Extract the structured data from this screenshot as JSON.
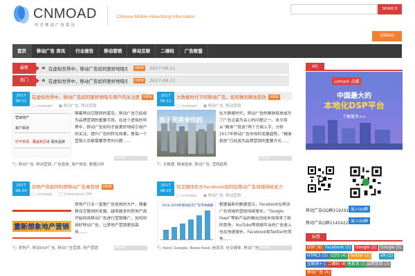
{
  "brand": {
    "name": "CNMOAD",
    "subtitle": "中文移动广告资讯",
    "tagline": "Chinese Mobile Advertising Information"
  },
  "search": {
    "placeholder": "",
    "button": "SEARCH"
  },
  "rss_label": "订阅RSS",
  "nav": [
    "首页",
    "移动广告 资讯",
    "行业报告",
    "移动营销",
    "移动互联",
    "二维码",
    "广告联盟"
  ],
  "ticker": [
    {
      "badge": "最新",
      "title": "在虚拟世界中，移动广告如何更好地吸引用户的关注度",
      "view": "VIEW",
      "date": "2017-09-11"
    },
    {
      "badge": "热门",
      "title": "在虚拟世界中，移动广告如何更好地吸引用户的关注度",
      "view": "VIEW",
      "date": "2017-09-11"
    }
  ],
  "articles": [
    {
      "year": "2017",
      "day": "09-11",
      "title": "在虚拟世界中，移动广告如何更好地吸引用户的关注度",
      "view": "VIEW",
      "author": "cnmoad",
      "comments": "",
      "category": "移动广告, 移动营销",
      "excerpt": "随着移动互联网的普及，移动广告已经成为品牌营销的重要手段。在这个虚拟的世界中，移动广告如何才能更好地吸引用户的关注，提升广告的转化效果，是每一个营销人员都需要思考的问题……",
      "read": "Read",
      "tags": "移动广告, 移动营销, 广告投放, 用户体验, 数据分析",
      "thumb_text": [
        "营销地产",
        "客户渠道",
        "打开资源、覆盖新区域",
        "服务品牌"
      ]
    },
    {
      "year": "2017",
      "day": "09-11",
      "title": "大数据时代下的移动广告，如何做到精准投放",
      "view": "VIEW",
      "author": "cnmoad",
      "comments": "",
      "category": "移动广告, 移动营销",
      "excerpt": "在大数据时代，移动广告的精准投放成为了广告主最为关心的问题之一。本文将从“精准”“投放”两个方面入手，分析2017年移动广告市场的发展趋势。“精准投放”已经成为品牌营销的重要方式……",
      "read": "Read",
      "tags": "大数据, 精准投放, 移动广告, 营销趋势",
      "thumb_text": [
        "房子是用来住的"
      ]
    },
    {
      "year": "2017",
      "day": "08-24",
      "title": "房地产商如何利用移动广告做营销",
      "view": "VIEW",
      "author": "cnmoad",
      "comments": "Comments Off",
      "category": "移动营销",
      "excerpt": "房地产行业一直是广告投放的大户，随着移动互联网的发展，越来越多的房地产商开始利用移动广告进行营销推广。如何利用好移动广告，让房地产营销更加高效……",
      "read": "Read",
      "tags": "房地产, 移动DSP广告, 移动广告营销, 地产营销",
      "thumb_text": [
        "重新想象地产营销"
      ]
    },
    {
      "year": "2017",
      "day": "08-23",
      "title": "社交媒体巨头Facebook如何在移动广告领域持续发力",
      "view": "",
      "author": "cnmoad",
      "comments": "",
      "category": "移动广告, 移动营销",
      "excerpt": "根据最新的数据显示，Facebook在移动广告领域的营收持续增长。“Google Feed”等新产品的推出也给市场带来了新的竞争。YouTube等视频平台的广告收入也在快速增长，Facebook和Twitter的竞争……",
      "read": "Read",
      "tags": "feed, Google, News feed, 信息流, 社交媒体, 移动广告",
      "thumb_text": [
        "2014-2019年移动社交广告市场规模"
      ]
    }
  ],
  "sidebar": {
    "ad_heading": "AD",
    "ad": {
      "brand": "Lomark 点媒",
      "headline1": "中国最大的",
      "headline2": "本地化DSP平台",
      "link": "了解更多>>"
    },
    "qq": [
      {
        "label": "移动广告QQ群",
        "number": "219291205",
        "button": "加入QQ群"
      },
      {
        "label": "移动广告Q群",
        "number": "114542205",
        "button": "加入QQ群"
      }
    ],
    "tags_heading": "标签",
    "tags": [
      {
        "text": "DSP (9)",
        "color": "#e06020"
      },
      {
        "text": "Facebook (5)",
        "color": "#2f8fd0"
      },
      {
        "text": "Google (2)",
        "color": "#e04040"
      },
      {
        "text": "Google (5)",
        "color": "#8a8a8a"
      },
      {
        "text": "HTML5 (5)",
        "color": "#3a7ac0"
      },
      {
        "text": "O2O (4)",
        "color": "#30a060"
      },
      {
        "text": "Twitter (2)",
        "color": "#f0a020"
      },
      {
        "text": "VR (2)",
        "color": "#2fa0c0"
      },
      {
        "text": "互联网+ (7)",
        "color": "#3a7ac0"
      },
      {
        "text": "二维码 (8)",
        "color": "#d43f3a"
      },
      {
        "text": "信息流 (3)",
        "color": "#30a060"
      },
      {
        "text": "品牌营销 (3)",
        "color": "#8a8a8a"
      },
      {
        "text": "移动广告 (4)",
        "color": "#e06020"
      }
    ]
  },
  "colors": {
    "accent": "#d43f3a",
    "orange": "#f08030",
    "nav_bg": "#3a3a3a",
    "date_badge": "#1aa0e0"
  }
}
